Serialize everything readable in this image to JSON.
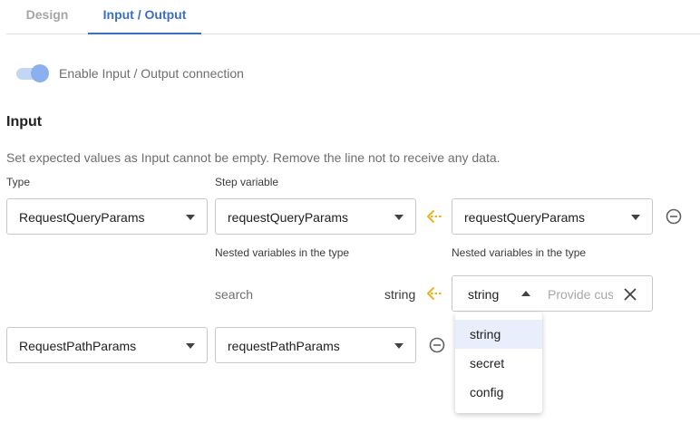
{
  "tabs": [
    {
      "label": "Design",
      "active": false
    },
    {
      "label": "Input / Output",
      "active": true
    }
  ],
  "connection_toggle": {
    "label": "Enable Input / Output connection",
    "enabled": true
  },
  "input_section": {
    "title": "Input",
    "help_text": "Set expected values as Input cannot be empty. Remove the line not to receive any data.",
    "col_type_label": "Type",
    "col_step_variable_label": "Step variable",
    "rows": [
      {
        "type_value": "RequestQueryParams",
        "step_variable_value": "requestQueryParams",
        "source_value": "requestQueryParams",
        "nested_label_left": "Nested variables in the type",
        "nested_label_right": "Nested variables in the type",
        "nested": {
          "name": "search",
          "type": "string",
          "source_type_value": "string",
          "custom_placeholder": "Provide custom value"
        }
      },
      {
        "type_value": "RequestPathParams",
        "step_variable_value": "requestPathParams"
      }
    ]
  },
  "dropdown": {
    "options": [
      "string",
      "secret",
      "config"
    ],
    "selected": "string"
  },
  "colors": {
    "accent": "#3a6fc4",
    "arrow": "#f2b01e",
    "toggle_track": "#c3d6f4",
    "toggle_knob": "#8ab0f0"
  },
  "icons": {
    "arrow": "arrow-left-dashed-icon",
    "remove": "minus-circle-icon",
    "clear": "close-icon",
    "dropdown": "chevron-down-icon"
  }
}
